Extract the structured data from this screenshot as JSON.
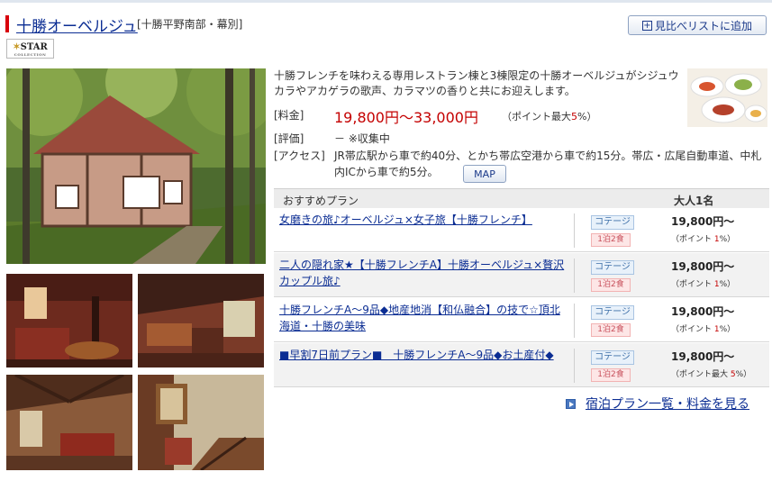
{
  "header": {
    "hotel_name": "十勝オーベルジュ",
    "area": "[十勝平野南部・幕別]",
    "compare_button": "見比べリストに追加"
  },
  "badge": {
    "main": "STAR",
    "sub": "COLLECTION"
  },
  "description": "十勝フレンチを味わえる専用レストラン棟と3棟限定の十勝オーベルジュがシジュウカラやアカゲラの歌声、カラマツの香りと共にお迎えします。",
  "info": {
    "price_label": "[料金]",
    "price_value": "19,800円～33,000円",
    "point_prefix": "（ポイント最大",
    "point_pct": "5",
    "point_suffix": "%）",
    "rating_label": "[評価]",
    "rating_value": "－ ※収集中",
    "access_label": "[アクセス]",
    "access_value": "JR帯広駅から車で約40分、とかち帯広空港から車で約15分。帯広・広尾自動車道、中札内ICから車で約5分。",
    "map_button": "MAP"
  },
  "plans_header": {
    "col1": "おすすめプラン",
    "col2": "大人1名"
  },
  "plans": [
    {
      "name": "女磨きの旅♪オーベルジュ×女子旅【十勝フレンチ】",
      "room": "コテージ",
      "meal": "1泊2食",
      "price": "19,800円～",
      "point_prefix": "（ポイント ",
      "point_pct": "1",
      "point_suffix": "%）"
    },
    {
      "name": "二人の隠れ家★【十勝フレンチA】十勝オーベルジュ×贅沢カップル旅♪",
      "room": "コテージ",
      "meal": "1泊2食",
      "price": "19,800円～",
      "point_prefix": "（ポイント ",
      "point_pct": "1",
      "point_suffix": "%）"
    },
    {
      "name": "十勝フレンチA～9品◆地産地消【和仏融合】の技で☆頂北海道・十勝の美味",
      "room": "コテージ",
      "meal": "1泊2食",
      "price": "19,800円～",
      "point_prefix": "（ポイント ",
      "point_pct": "1",
      "point_suffix": "%）"
    },
    {
      "name": "■早割7日前プラン■　十勝フレンチA～9品◆お土産付◆",
      "room": "コテージ",
      "meal": "1泊2食",
      "price": "19,800円～",
      "point_prefix": "（ポイント最大 ",
      "point_pct": "5",
      "point_suffix": "%）"
    }
  ],
  "more_link": "宿泊プラン一覧・料金を見る",
  "colors": {
    "link": "#0b2d93",
    "price": "#c40000",
    "accent_red": "#d8000c",
    "table_header": "#ececec"
  }
}
